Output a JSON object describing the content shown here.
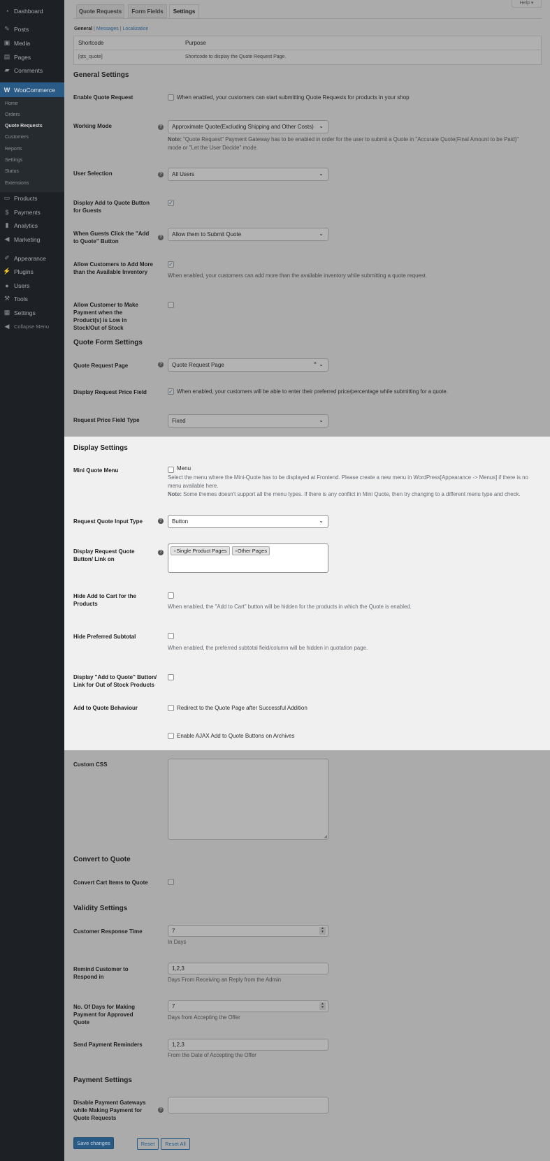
{
  "sidebar": {
    "items": [
      {
        "label": "Dashboard",
        "icon": "dashboard-icon"
      },
      {
        "label": "Posts",
        "icon": "pin-icon"
      },
      {
        "label": "Media",
        "icon": "media-icon"
      },
      {
        "label": "Pages",
        "icon": "pages-icon"
      },
      {
        "label": "Comments",
        "icon": "comment-icon"
      },
      {
        "label": "WooCommerce",
        "icon": "woocommerce-icon"
      },
      {
        "label": "Products",
        "icon": "archive-icon"
      },
      {
        "label": "Payments",
        "icon": "dollar-icon"
      },
      {
        "label": "Analytics",
        "icon": "bar-chart-icon"
      },
      {
        "label": "Marketing",
        "icon": "megaphone-icon"
      },
      {
        "label": "Appearance",
        "icon": "brush-icon"
      },
      {
        "label": "Plugins",
        "icon": "plug-icon"
      },
      {
        "label": "Users",
        "icon": "user-icon"
      },
      {
        "label": "Tools",
        "icon": "wrench-icon"
      },
      {
        "label": "Settings",
        "icon": "settings-icon"
      },
      {
        "label": "Collapse Menu",
        "icon": "collapse-icon"
      }
    ],
    "submenu": [
      "Home",
      "Orders",
      "Quote Requests",
      "Customers",
      "Reports",
      "Settings",
      "Status",
      "Extensions"
    ]
  },
  "help_label": "Help ▾",
  "tabs": [
    "Quote Requests",
    "Form Fields",
    "Settings"
  ],
  "subnav": {
    "general": "General",
    "messages": "Messages",
    "localization": "Localization"
  },
  "shortcode_table": {
    "headers": [
      "Shortcode",
      "Purpose"
    ],
    "rows": [
      [
        "[qts_quote]",
        "Shortcode to display the Quote Request Page."
      ]
    ]
  },
  "general": {
    "title": "General Settings",
    "enable_label": "Enable Quote Request",
    "enable_text": "When enabled, your customers can start submitting Quote Requests for products in your shop",
    "mode_label": "Working Mode",
    "mode_value": "Approximate Quote(Excluding Shipping and Other Costs)",
    "mode_note_bold": "Note:",
    "mode_note": " \"Quote Request\" Payment Gateway has to be enabled in order for the user to submit a Quote in \"Accurate Quote(Final Amount to be Paid)\"",
    "mode_note2": "mode or \"Let the User Decide\" mode.",
    "user_label": "User Selection",
    "user_value": "All Users",
    "guest_btn_label": "Display Add to Quote Button for Guests",
    "guest_click_label": "When Guests Click the \"Add to Quote\" Button",
    "guest_click_value": "Allow them to Submit Quote",
    "inventory_label": "Allow Customers to Add More than the Available Inventory",
    "inventory_desc": "When enabled, your customers can add more than the available inventory while submitting a quote request.",
    "lowstock_label": "Allow Customer to Make Payment when the Product(s) is Low in Stock/Out of Stock"
  },
  "quote_form": {
    "title": "Quote Form Settings",
    "page_label": "Quote Request Page",
    "page_value": "Quote Request Page",
    "price_field_label": "Display Request Price Field",
    "price_field_text": "When enabled, your customers will be able to enter their preferred price/percentage while submitting for a quote.",
    "price_type_label": "Request Price Field Type",
    "price_type_value": "Fixed"
  },
  "display": {
    "title": "Display Settings",
    "mini_label": "Mini Quote Menu",
    "mini_option": "Menu",
    "mini_desc1": "Select the menu where the Mini-Quote has to be displayed at Frontend. Please create a new menu in WordPress[Appearance -> Menus] if there is no",
    "mini_desc2": "menu available here.",
    "mini_note_bold": "Note:",
    "mini_note": " Some themes doesn't support all the menu types. If there is any conflict in Mini Quote, then try changing to a different menu type and check.",
    "input_type_label": "Request Quote Input Type",
    "input_type_value": "Button",
    "display_on_label": "Display Request Quote Button/ Link on",
    "display_on_tags": [
      "Single Product Pages",
      "Other Pages"
    ],
    "hide_cart_label": "Hide Add to Cart for the Products",
    "hide_cart_desc": "When enabled, the \"Add to Cart\" button will be hidden for the products in which the Quote is enabled.",
    "hide_subtotal_label": "Hide Preferred Subtotal",
    "hide_subtotal_desc": "When enabled, the preferred subtotal field/column will be hidden in quotation page.",
    "oos_label": "Display \"Add to Quote\" Button/ Link for Out of Stock Products",
    "behaviour_label": "Add to Quote Behaviour",
    "behaviour_redirect": "Redirect to the Quote Page after Successful Addition",
    "behaviour_ajax": "Enable AJAX Add to Quote Buttons on Archives"
  },
  "custom_css_label": "Custom CSS",
  "convert": {
    "title": "Convert to Quote",
    "cart_label": "Convert Cart Items to Quote"
  },
  "validity": {
    "title": "Validity Settings",
    "response_label": "Customer Response Time",
    "response_value": "7",
    "response_desc": "In Days",
    "remind_label": "Remind Customer to Respond in",
    "remind_value": "1,2,3",
    "remind_desc": "Days From Receiving an Reply from the Admin",
    "payment_days_label": "No. Of Days for Making Payment for Approved Quote",
    "payment_days_value": "7",
    "payment_days_desc": "Days from Accepting the Offer",
    "reminders_label": "Send Payment Reminders",
    "reminders_value": "1,2,3",
    "reminders_desc": "From the Date of Accepting the Offer"
  },
  "payment": {
    "title": "Payment Settings",
    "gateways_label": "Disable Payment Gateways while Making Payment for Quote Requests"
  },
  "buttons": {
    "save": "Save changes",
    "reset": "Reset",
    "reset_all": "Reset All"
  }
}
